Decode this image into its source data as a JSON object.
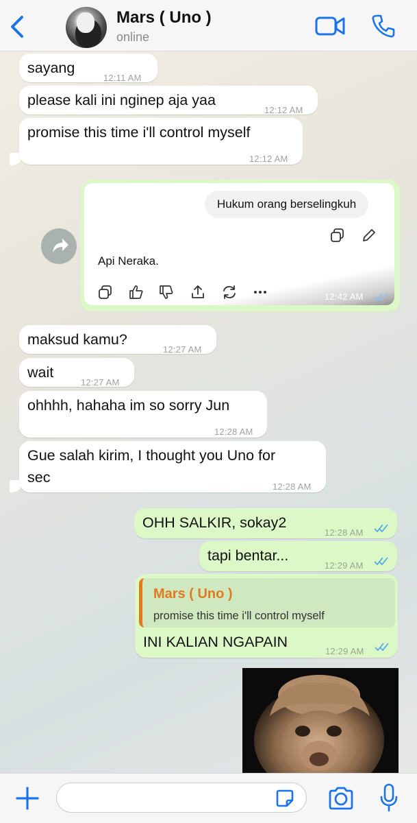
{
  "header": {
    "contact_name": "Mars ( Uno )",
    "status": "online",
    "back_icon": "chevron-left-icon",
    "video_icon": "video-camera-icon",
    "call_icon": "phone-icon",
    "accent_color": "#1a73e8"
  },
  "messages": [
    {
      "text": "sayang",
      "time": "12:11 AM",
      "direction": "incoming"
    },
    {
      "text": "please kali ini nginep aja yaa",
      "time": "12:12 AM",
      "direction": "incoming"
    },
    {
      "text": "promise this time i'll control myself",
      "time": "12:12 AM",
      "direction": "incoming"
    },
    {
      "text": "maksud kamu?",
      "time": "12:27 AM",
      "direction": "incoming"
    },
    {
      "text": "wait",
      "time": "12:27 AM",
      "direction": "incoming"
    },
    {
      "text": "ohhhh, hahaha im so sorry Jun",
      "time": "12:28 AM",
      "direction": "incoming"
    },
    {
      "text_line1": "Gue salah kirim, I thought you Uno for",
      "text_line2": "sec",
      "time": "12:28 AM",
      "direction": "incoming"
    },
    {
      "text": "OHH SALKIR, sokay2",
      "time": "12:28 AM",
      "direction": "outgoing"
    },
    {
      "text": "tapi bentar...",
      "time": "12:29 AM",
      "direction": "outgoing"
    },
    {
      "text": "INI KALIAN NGAPAIN",
      "time": "12:29 AM",
      "direction": "outgoing"
    }
  ],
  "forwarded": {
    "question": "Hukum orang berselingkuh",
    "answer": "Api Neraka.",
    "time": "12:42 AM",
    "forward_icon": "share-arrow-icon",
    "tools": [
      "copy-icon",
      "thumbs-up-icon",
      "thumbs-down-icon",
      "share-icon",
      "regenerate-icon",
      "more-icon"
    ],
    "edit_icons": [
      "copy-icon",
      "pencil-icon"
    ]
  },
  "reply": {
    "quoted_name": "Mars ( Uno )",
    "quoted_text": "promise this time i'll control myself",
    "quote_color": "#e07a1f"
  },
  "composer": {
    "placeholder": "",
    "plus_icon": "plus-icon",
    "sticker_icon": "sticker-icon",
    "camera_icon": "camera-icon",
    "mic_icon": "microphone-icon"
  }
}
